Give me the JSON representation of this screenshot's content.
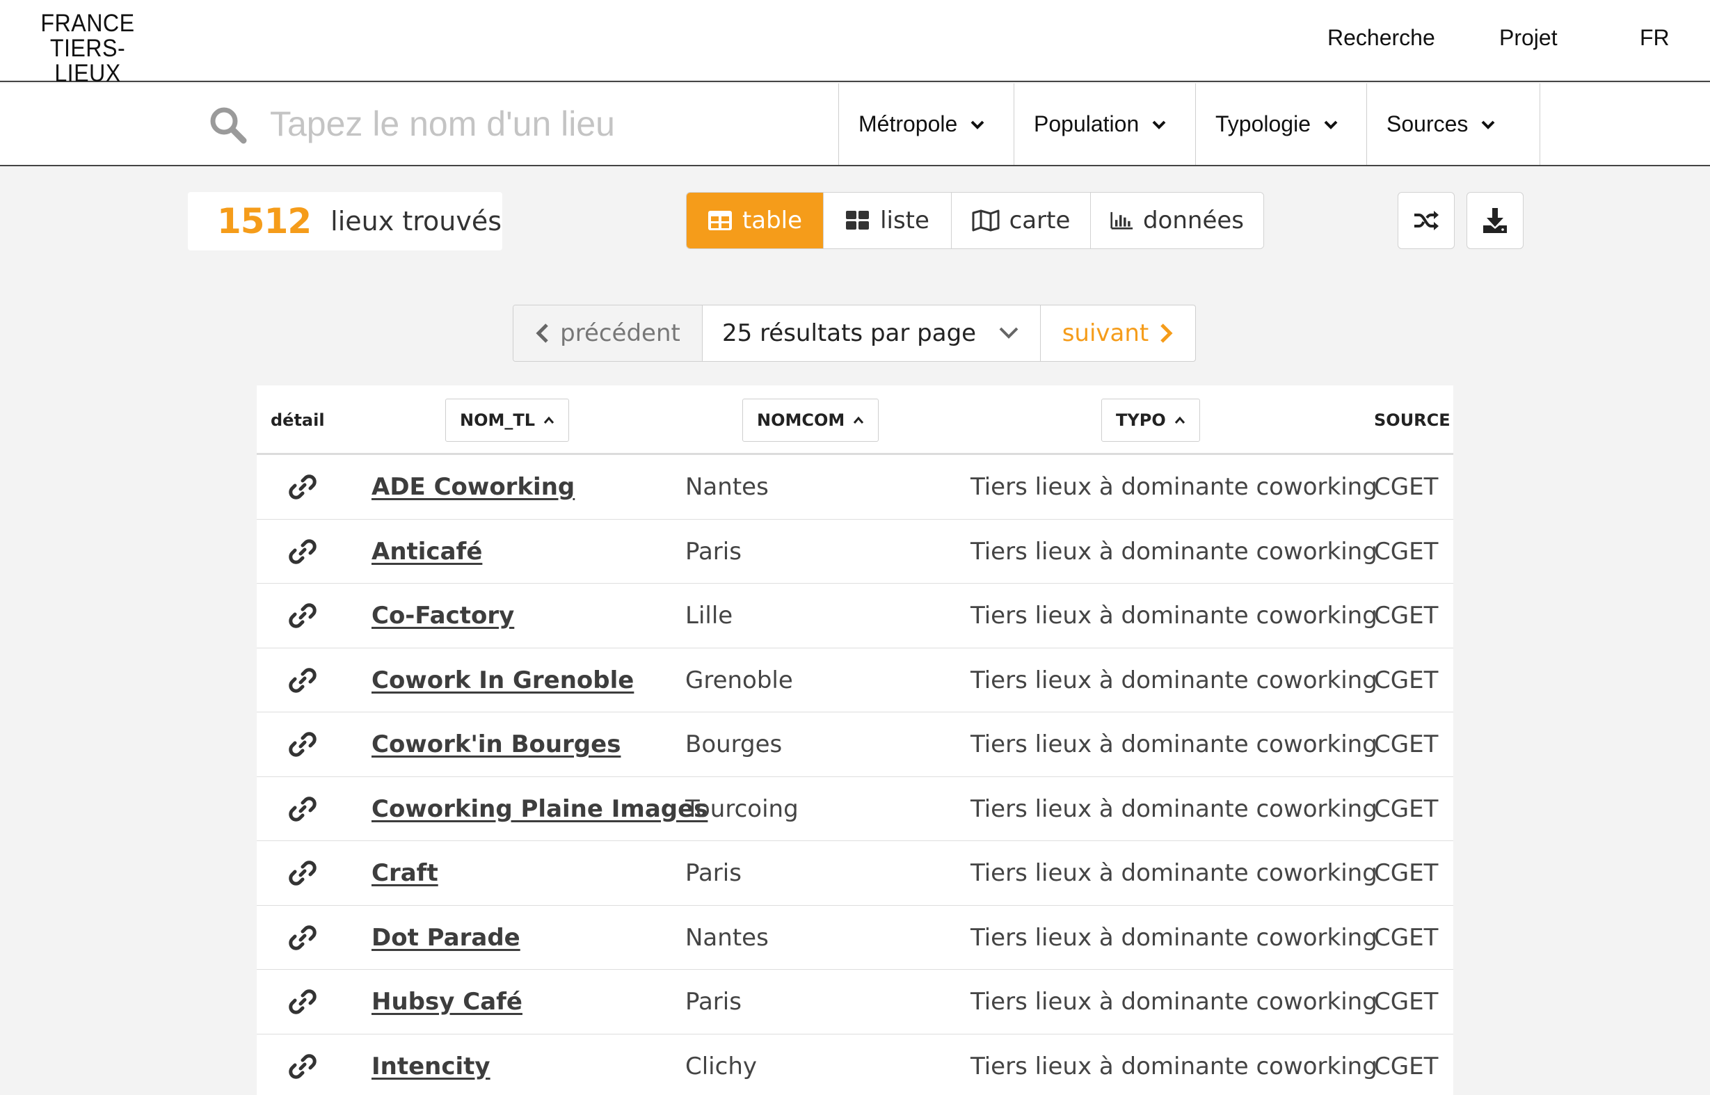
{
  "brand": {
    "line1": "FRANCE",
    "line2": "TIERS-LIEUX",
    "accent": "#f59c1a"
  },
  "topnav": {
    "search": "Recherche",
    "project": "Projet",
    "lang": "FR"
  },
  "search": {
    "placeholder": "Tapez le nom d'un lieu",
    "value": "",
    "icon": "search-icon"
  },
  "filters": [
    "Métropole",
    "Population",
    "Typologie",
    "Sources"
  ],
  "results": {
    "count": "1512",
    "label": "lieux trouvés"
  },
  "views": [
    {
      "label": "table",
      "icon": "table-icon",
      "active": true
    },
    {
      "label": "liste",
      "icon": "grid-icon",
      "active": false
    },
    {
      "label": "carte",
      "icon": "map-icon",
      "active": false
    },
    {
      "label": "données",
      "icon": "bar-chart-icon",
      "active": false
    }
  ],
  "actions": {
    "shuffle": "shuffle-icon",
    "download": "download-icon"
  },
  "pagination": {
    "prev": "précédent",
    "per_page": "25 résultats par page",
    "next": "suivant"
  },
  "table": {
    "headers": {
      "detail": "détail",
      "name": "NOM_TL",
      "city": "NOMCOM",
      "type": "TYPO",
      "source": "SOURCE"
    },
    "rows": [
      {
        "name": "ADE Coworking",
        "city": "Nantes",
        "type": "Tiers lieux à dominante coworking",
        "source": "CGET"
      },
      {
        "name": "Anticafé",
        "city": "Paris",
        "type": "Tiers lieux à dominante coworking",
        "source": "CGET"
      },
      {
        "name": "Co-Factory",
        "city": "Lille",
        "type": "Tiers lieux à dominante coworking",
        "source": "CGET"
      },
      {
        "name": "Cowork In Grenoble",
        "city": "Grenoble",
        "type": "Tiers lieux à dominante coworking",
        "source": "CGET"
      },
      {
        "name": "Cowork'in Bourges",
        "city": "Bourges",
        "type": "Tiers lieux à dominante coworking",
        "source": "CGET"
      },
      {
        "name": "Coworking Plaine Images",
        "city": "Tourcoing",
        "type": "Tiers lieux à dominante coworking",
        "source": "CGET"
      },
      {
        "name": "Craft",
        "city": "Paris",
        "type": "Tiers lieux à dominante coworking",
        "source": "CGET"
      },
      {
        "name": "Dot Parade",
        "city": "Nantes",
        "type": "Tiers lieux à dominante coworking",
        "source": "CGET"
      },
      {
        "name": "Hubsy Café",
        "city": "Paris",
        "type": "Tiers lieux à dominante coworking",
        "source": "CGET"
      },
      {
        "name": "Intencity",
        "city": "Clichy",
        "type": "Tiers lieux à dominante coworking",
        "source": "CGET"
      }
    ]
  }
}
